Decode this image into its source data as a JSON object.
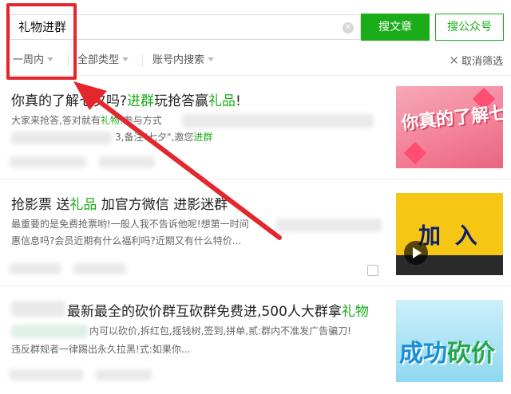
{
  "search": {
    "query": "礼物进群",
    "clear_icon": "clear-icon",
    "search_articles_label": "搜文章",
    "search_accounts_label": "搜公众号"
  },
  "filters": {
    "time_label": "一周内",
    "type_label": "全部类型",
    "scope_label": "账号内搜索",
    "cancel_label": "取消筛选"
  },
  "results": [
    {
      "title_pre": "你真的了解七夕吗?",
      "title_hl": "进群",
      "title_mid": "玩抢答赢",
      "title_hl2": "礼品",
      "title_post": "!",
      "snippet_line1_pre": "大家来抢答,答对就有",
      "snippet_line1_hl": "礼物",
      "snippet_line1_post": "!参与方式",
      "snippet_line2_pre": "3,备注\"七夕\",邀您",
      "snippet_line2_hl": "进群",
      "thumb_text": "你真的了解七夕吗"
    },
    {
      "title_pre": "抢影票 送",
      "title_hl": "礼品",
      "title_mid": " 加官方微信 进影迷群",
      "snippet_line1": "最重要的是免费抢票哟!一般人我不告诉他呢!想第一时间",
      "snippet_line2": "惠信息吗?会员近期有什么福利吗?近期又有什么特价...",
      "thumb_text": "加 入"
    },
    {
      "title_pre": "最新最全的砍价群互砍群免费进,500人大群拿",
      "title_hl": "礼物",
      "snippet_line1": "内可以砍价,拆红包,摇钱树,签到,拼单,贰:群内不准发广告骗刀!",
      "snippet_line2": "违反群规者一律踢出永久拉黑!式:如果你...",
      "thumb_text_a": "成功",
      "thumb_text_b": "砍价"
    }
  ],
  "colors": {
    "accent": "#1aad19",
    "annotation": "#e4262d"
  }
}
